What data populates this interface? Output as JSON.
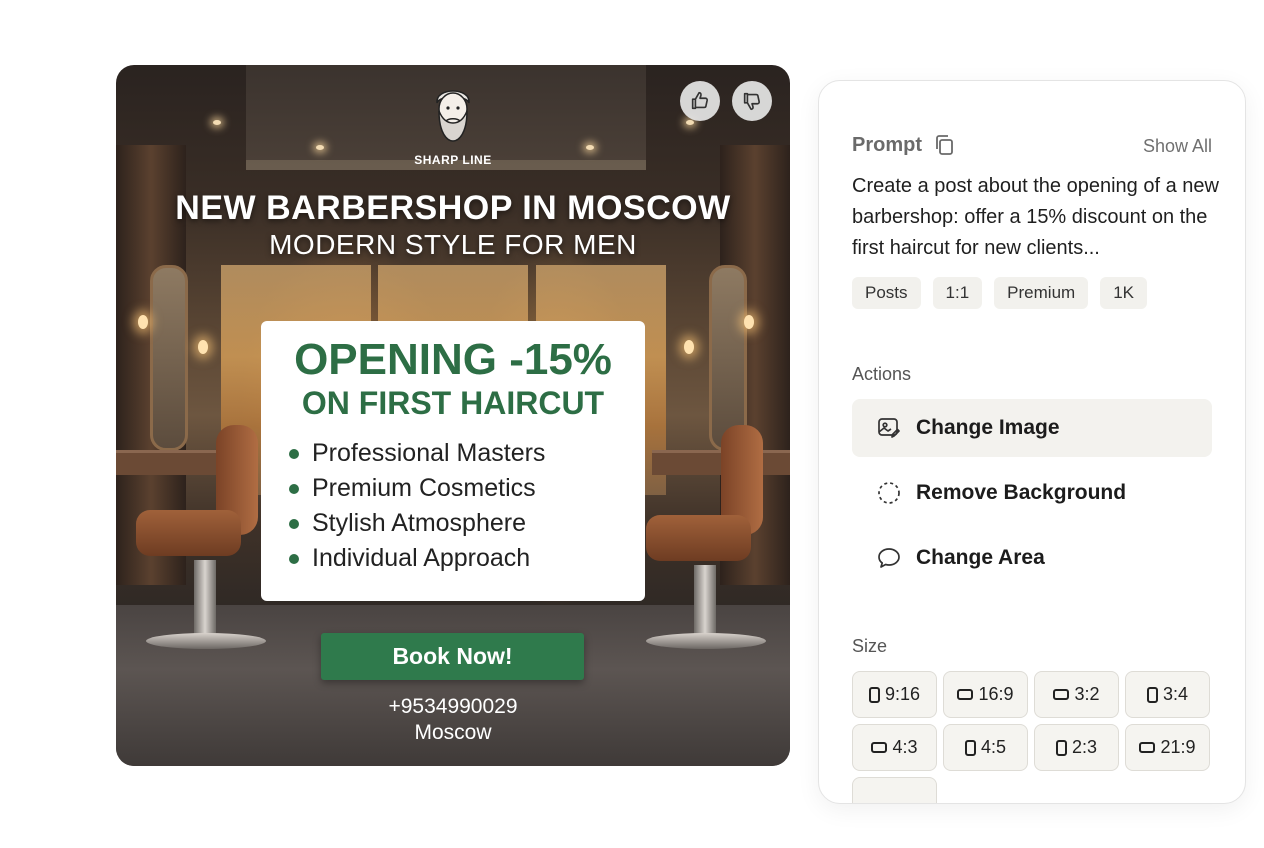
{
  "image": {
    "brand_name": "SHARP LINE",
    "headline": "NEW BARBERSHOP IN MOSCOW",
    "subheadline": "MODERN STYLE FOR MEN",
    "offer_line1": "OPENING -15%",
    "offer_line2": "ON FIRST HAIRCUT",
    "features": [
      "Professional Masters",
      "Premium Cosmetics",
      "Stylish Atmosphere",
      "Individual Approach"
    ],
    "cta": "Book Now!",
    "phone": "+9534990029",
    "city": "Moscow",
    "colors": {
      "accent_green": "#2d6e45",
      "button_green": "#2f7a4c"
    },
    "rating_icons": [
      "thumbs-up-icon",
      "thumbs-down-icon"
    ]
  },
  "panel": {
    "prompt_title": "Prompt",
    "show_all": "Show All",
    "prompt_text": "Create a post about the opening of a new barbershop: offer a 15% discount on the first haircut for new clients...",
    "tags": [
      "Posts",
      "1:1",
      "Premium",
      "1K"
    ],
    "actions_label": "Actions",
    "actions": [
      {
        "label": "Change Image",
        "icon": "image-edit-icon",
        "active": true
      },
      {
        "label": "Remove Background",
        "icon": "dashed-circle-icon",
        "active": false
      },
      {
        "label": "Change Area",
        "icon": "speech-bubble-icon",
        "active": false
      }
    ],
    "size_label": "Size",
    "sizes": [
      {
        "label": "9:16",
        "shape": "portrait"
      },
      {
        "label": "16:9",
        "shape": "landscape"
      },
      {
        "label": "3:2",
        "shape": "landscape"
      },
      {
        "label": "3:4",
        "shape": "portrait"
      },
      {
        "label": "4:3",
        "shape": "landscape"
      },
      {
        "label": "4:5",
        "shape": "portrait"
      },
      {
        "label": "2:3",
        "shape": "portrait"
      },
      {
        "label": "21:9",
        "shape": "landscape"
      }
    ],
    "colors": {
      "active_bg": "#f3f2ee",
      "tag_bg": "#f2f1ed"
    }
  }
}
